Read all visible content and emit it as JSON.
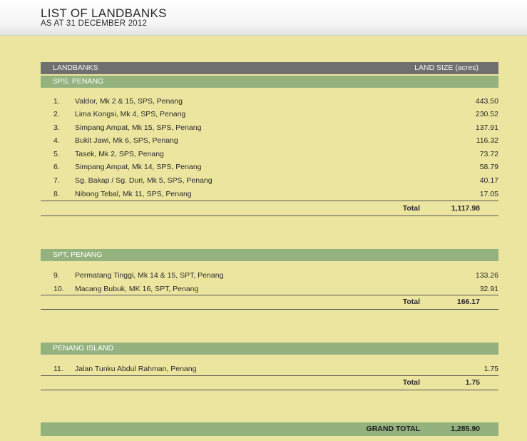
{
  "header": {
    "title": "LIST OF LANDBANKS",
    "subtitle": "AS AT 31 DECEMBER 2012"
  },
  "table_header": {
    "col_landbanks": "LANDBANKS",
    "col_land_size": "LAND SIZE (acres)"
  },
  "sections": [
    {
      "heading": "SPS, PENANG",
      "rows": [
        {
          "no": "1.",
          "name": "Valdor, Mk 2 & 15, SPS, Penang",
          "size": "443.50"
        },
        {
          "no": "2.",
          "name": "Lima Kongsi, Mk 4, SPS, Penang",
          "size": "230.52"
        },
        {
          "no": "3.",
          "name": "Simpang Ampat, Mk 15, SPS, Penang",
          "size": "137.91"
        },
        {
          "no": "4.",
          "name": "Bukit Jawi, Mk 6, SPS, Penang",
          "size": "116.32"
        },
        {
          "no": "5.",
          "name": "Tasek, Mk 2, SPS, Penang",
          "size": "73.72"
        },
        {
          "no": "6.",
          "name": "Simpang Ampat, Mk 14, SPS, Penang",
          "size": "58.79"
        },
        {
          "no": "7.",
          "name": "Sg. Bakap / Sg. Duri, Mk 5, SPS, Penang",
          "size": "40.17"
        },
        {
          "no": "8.",
          "name": "Nibong Tebal, Mk 11, SPS, Penang",
          "size": "17.05"
        }
      ],
      "total_label": "Total",
      "total_value": "1,117.98"
    },
    {
      "heading": "SPT, PENANG",
      "rows": [
        {
          "no": "9.",
          "name": "Permatang Tinggi, Mk 14 & 15, SPT, Penang",
          "size": "133.26"
        },
        {
          "no": "10.",
          "name": "Macang Bubuk, MK 16, SPT, Penang",
          "size": "32.91"
        }
      ],
      "total_label": "Total",
      "total_value": "166.17"
    },
    {
      "heading": "PENANG ISLAND",
      "rows": [
        {
          "no": "11.",
          "name": "Jalan Tunku Abdul Rahman, Penang",
          "size": "1.75"
        }
      ],
      "total_label": "Total",
      "total_value": "1.75"
    }
  ],
  "grand_total": {
    "label": "GRAND TOTAL",
    "value": "1,285.90"
  },
  "colors": {
    "background": "#ece59f",
    "header_band": "#6f6f6f",
    "section_band": "#93b27e"
  }
}
